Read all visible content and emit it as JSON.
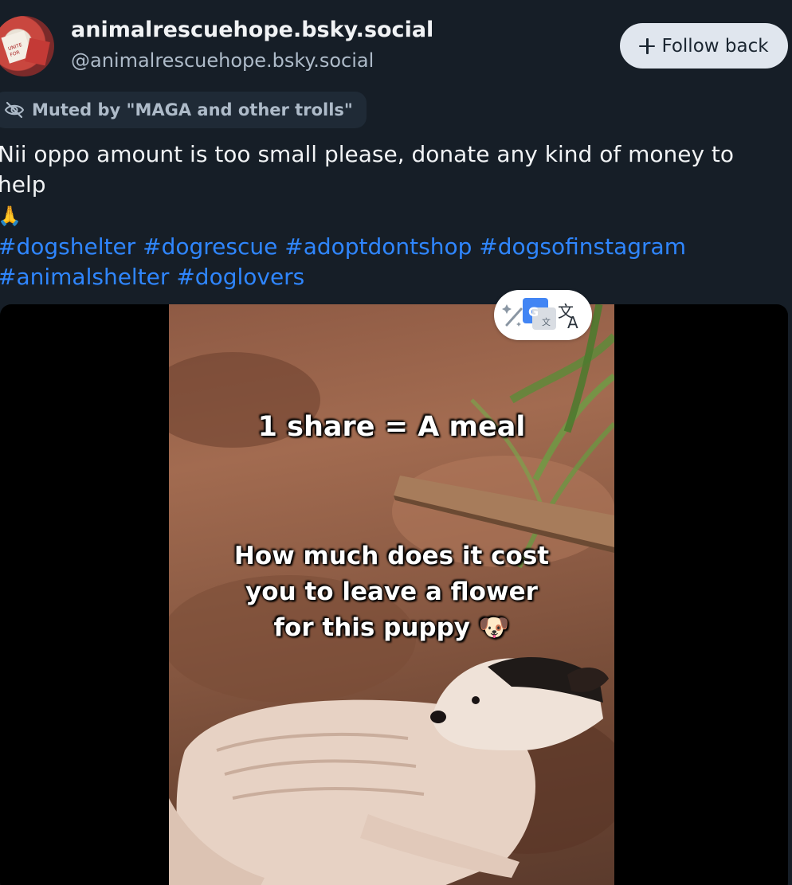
{
  "author": {
    "display_name": "animalrescuehope.bsky.social",
    "handle": "@animalrescuehope.bsky.social",
    "avatar_icon": "avatar-protest-sign",
    "avatar_sign_text": "UNITE FOR ANIMALS JUSTICE"
  },
  "follow_button": {
    "label": "Follow back",
    "icon": "plus-icon"
  },
  "muted": {
    "icon": "eye-off-icon",
    "label": "Muted by \"MAGA and other trolls\""
  },
  "post": {
    "text": "Nii oppo amount is too small please, donate any kind of money to help",
    "emoji": "🙏",
    "hashtags": [
      "#dogshelter",
      "#dogrescue",
      "#adoptdontshop",
      "#dogsofinstagram",
      "#animalshelter",
      "#doglovers"
    ]
  },
  "media": {
    "caption_1": "1 share = A meal",
    "caption_2_line_1": "How much does it cost",
    "caption_2_line_2": "you to leave a flower",
    "caption_2_line_3": "for this puppy",
    "caption_emoji": "🐶",
    "translate_icon": "translate-icon",
    "colors": {
      "ground": "#8e5a44",
      "dog": "#e9d4c8",
      "media_bg": "#000000"
    }
  },
  "colors": {
    "background": "#161e27",
    "link": "#2f86ff",
    "text": "#f1f3f5",
    "muted_text": "#aebbc9",
    "button_bg": "#e0e6ee"
  }
}
